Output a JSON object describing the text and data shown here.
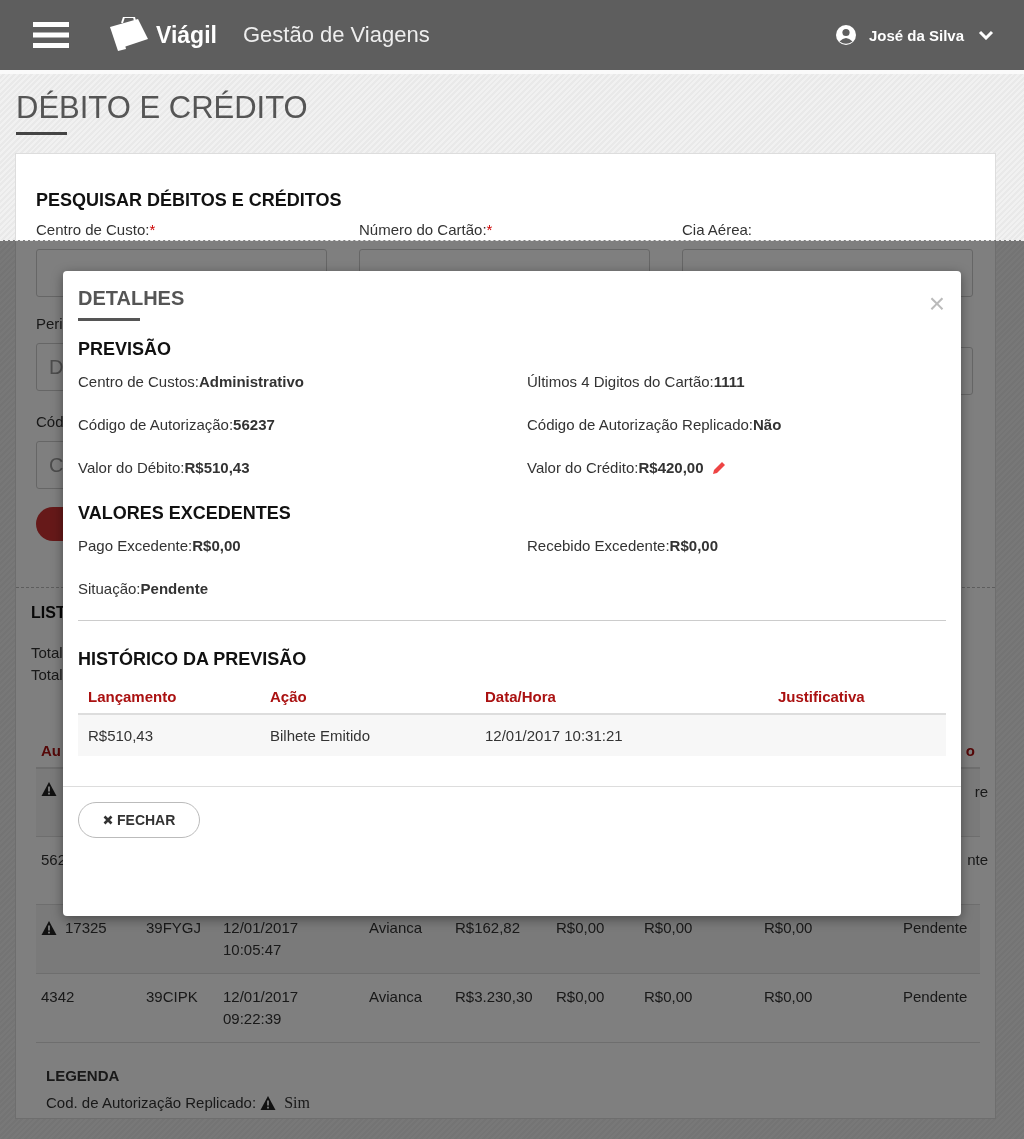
{
  "header": {
    "brand": "Viágil",
    "subtitle": "Gestão de Viagens",
    "user": "José da Silva"
  },
  "page_title": "DÉBITO E CRÉDITO",
  "search": {
    "title": "PESQUISAR DÉBITOS E CRÉDITOS",
    "labels": [
      {
        "text": "Centro de Custo:",
        "mark": "*"
      },
      {
        "text": "Número do Cartão:",
        "mark": "*"
      },
      {
        "text": "Cia Aérea:"
      }
    ],
    "second_row": {
      "label": "Peri",
      "placeholder": "D"
    },
    "third_row": {
      "label": "Cód",
      "placeholder": "C"
    }
  },
  "list": {
    "title": "LIST",
    "totals": [
      "Total",
      "Total"
    ],
    "header": {
      "column_1": "Au",
      "column_9": "o"
    },
    "rows": [
      {
        "flagged": true,
        "column_9": "re"
      },
      {
        "flagged": false,
        "column_1": "562",
        "column_9": "nte"
      },
      {
        "flagged": true,
        "column_1": "17325",
        "column_2": "39FYGJ",
        "column_3": "12/01/2017 10:05:47",
        "column_4": "Avianca",
        "column_5": "R$162,82",
        "column_6": "R$0,00",
        "column_7": "R$0,00",
        "column_8": "R$0,00",
        "column_9": "Pendente"
      },
      {
        "flagged": false,
        "column_1": "4342",
        "column_2": "39CIPK",
        "column_3": "12/01/2017 09:22:39",
        "column_4": "Avianca",
        "column_5": "R$3.230,30",
        "column_6": "R$0,00",
        "column_7": "R$0,00",
        "column_8": "R$0,00",
        "column_9": "Pendente"
      }
    ],
    "legend": {
      "title": "LEGENDA",
      "label": "Cod. de Autorização Replicado:",
      "value": "Sim"
    }
  },
  "modal": {
    "title": "DETALHES",
    "close": "×",
    "sections": [
      {
        "title": "PREVISÃO",
        "fields": [
          {
            "label": "Centro de Custos:",
            "value": "Administrativo",
            "editable": false
          },
          {
            "label": "Últimos 4 Digitos do Cartão:",
            "value": "1111",
            "editable": false
          },
          {
            "label": "Código de Autorização:",
            "value": "56237",
            "editable": false
          },
          {
            "label": "Código de Autorização Replicado:",
            "value": "Não",
            "editable": false
          },
          {
            "label": "Valor do Débito:",
            "value": "R$510,43",
            "editable": false
          },
          {
            "label": "Valor do Crédito:",
            "value": "R$420,00",
            "editable": true
          }
        ]
      },
      {
        "title": "VALORES EXCEDENTES",
        "fields": [
          {
            "label": "Pago Excedente:",
            "value": "R$0,00",
            "editable": false
          },
          {
            "label": "Recebido Excedente:",
            "value": "R$0,00",
            "editable": false
          },
          {
            "label": "Situação:",
            "value": "Pendente",
            "editable": false
          }
        ]
      }
    ],
    "history": {
      "title": "HISTÓRICO DA PREVISÃO",
      "columns": [
        "Lançamento",
        "Ação",
        "Data/Hora",
        "Justificativa"
      ],
      "rows": [
        [
          "R$510,43",
          "Bilhete Emitido",
          "12/01/2017 10:31:21"
        ]
      ]
    },
    "button": "FECHAR"
  }
}
